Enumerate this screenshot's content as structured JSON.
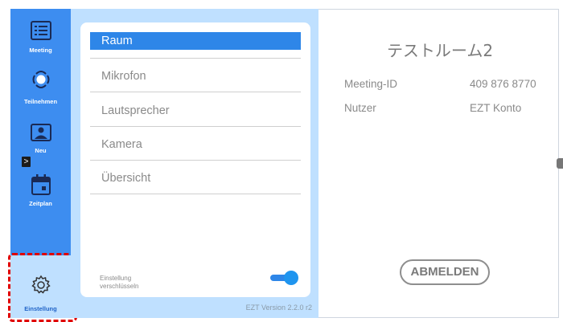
{
  "sidebar": {
    "items": [
      {
        "label": "Meeting",
        "icon": "meeting-list-icon"
      },
      {
        "label": "Teilnehmen",
        "icon": "join-icon"
      },
      {
        "label": "Neu",
        "icon": "new-meeting-icon"
      },
      {
        "label": "Zeitplan",
        "icon": "calendar-icon"
      },
      {
        "label": "Einstellung",
        "icon": "gear-icon",
        "active": true
      }
    ],
    "collapse_glyph": ">"
  },
  "settings_menu": {
    "items": [
      "Raum",
      "Mikrofon",
      "Lautsprecher",
      "Kamera",
      "Übersicht"
    ],
    "selected": "Raum"
  },
  "encryption": {
    "label": "Einstellung verschlüsseln",
    "enabled": true
  },
  "version": "EZT Version 2.2.0 r2",
  "room": {
    "title": "テストルーム2",
    "meeting_id_label": "Meeting-ID",
    "meeting_id_value": "409 876 8770",
    "user_label": "Nutzer",
    "user_value": "EZT Konto"
  },
  "logout_label": "ABMELDEN",
  "colors": {
    "sidebar": "#3d8df0",
    "panel": "#bfe0ff",
    "accent": "#2e86e8",
    "highlight": "#e00000"
  }
}
